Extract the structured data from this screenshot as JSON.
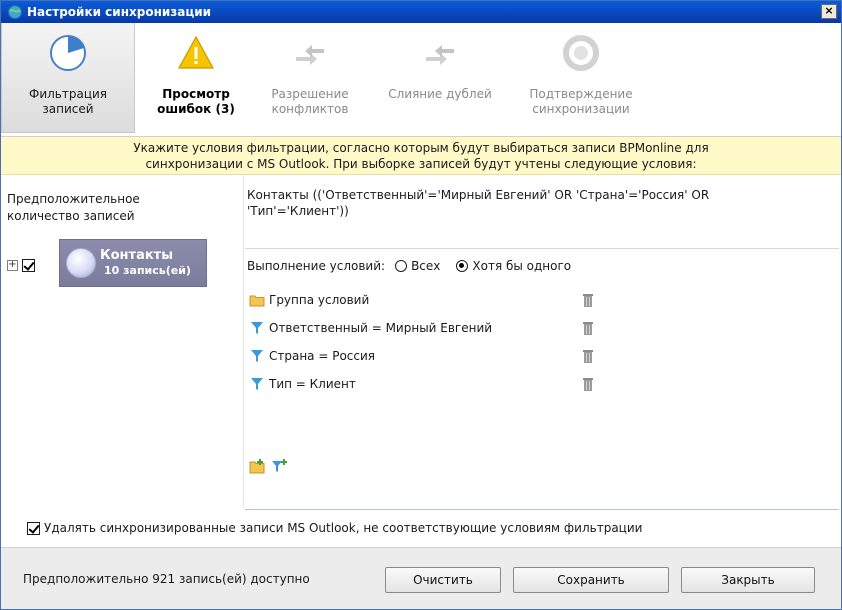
{
  "window": {
    "title": "Настройки синхронизации",
    "close_label": "×"
  },
  "toolbar": {
    "items": [
      {
        "line1": "Фильтрация",
        "line2": "записей"
      },
      {
        "line1": "Просмотр",
        "line2": "ошибок (3)"
      },
      {
        "line1": "Разрешение",
        "line2": "конфликтов"
      },
      {
        "line1": "Слияние дублей",
        "line2": ""
      },
      {
        "line1": "Подтверждение",
        "line2": "синхронизации"
      }
    ]
  },
  "banner": {
    "line1": "Укажите условия фильтрации, согласно которым будут выбираться записи BPMonline для",
    "line2": "синхронизации с MS Outlook. При выборке записей будут учтены следующие условия:"
  },
  "left": {
    "label_line1": "Предположительное",
    "label_line2": "количество записей",
    "node_name": "Контакты",
    "node_count": "10 запись(ей)"
  },
  "filter": {
    "expression_line1": "Контакты (('Ответственный'='Мирный Евгений' OR 'Страна'='Россия' OR",
    "expression_line2": "'Тип'='Клиент'))",
    "conditions_label": "Выполнение условий:",
    "option_all": "Всех",
    "option_any": "Хотя бы одного",
    "items": [
      {
        "label": "Группа условий",
        "icon": "folder-icon"
      },
      {
        "label": "Ответственный = Мирный Евгений",
        "icon": "filter-icon"
      },
      {
        "label": "Страна = Россия",
        "icon": "filter-icon"
      },
      {
        "label": "Тип = Клиент",
        "icon": "filter-icon"
      }
    ]
  },
  "delete_option": {
    "label": "Удалять синхронизированные записи MS Outlook, не соответствующие условиям фильтрации"
  },
  "footer": {
    "status": "Предположительно 921 запись(ей) доступно",
    "clear": "Очистить",
    "save": "Сохранить",
    "close": "Закрыть"
  },
  "colors": {
    "title_bar": "#0839a6",
    "banner": "#fff9c8",
    "node": "#7b7c9c",
    "filter_icon": "#3a9ad9"
  }
}
